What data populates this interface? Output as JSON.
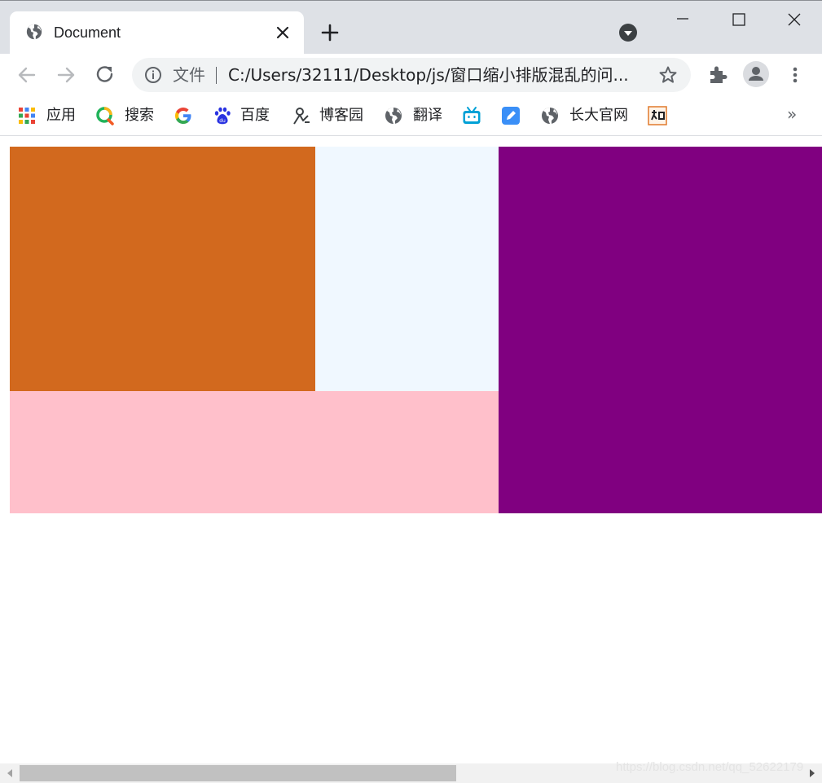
{
  "tab": {
    "title": "Document",
    "favicon": "globe-icon"
  },
  "omnibox": {
    "scheme_label": "文件",
    "url": "C:/Users/32111/Desktop/js/窗口缩小排版混乱的问..."
  },
  "bookmarks": [
    {
      "label": "应用",
      "icon": "apps-grid-icon"
    },
    {
      "label": "搜索",
      "icon": "search-o-icon"
    },
    {
      "label": "",
      "icon": "google-icon"
    },
    {
      "label": "百度",
      "icon": "baidu-paw-icon"
    },
    {
      "label": "博客园",
      "icon": "cnblogs-icon"
    },
    {
      "label": "翻译",
      "icon": "globe-icon"
    },
    {
      "label": "",
      "icon": "bilibili-icon"
    },
    {
      "label": "",
      "icon": "blue-note-icon"
    },
    {
      "label": "长大官网",
      "icon": "globe-icon"
    },
    {
      "label": "",
      "icon": "zhi-icon"
    }
  ],
  "bookmarks_more": "»",
  "boxes": {
    "orange": "#d2691e",
    "lightblue": "#f0f8ff",
    "pink": "#ffc0cb",
    "purple": "#800080"
  },
  "watermark": "https://blog.csdn.net/qq_52622179"
}
